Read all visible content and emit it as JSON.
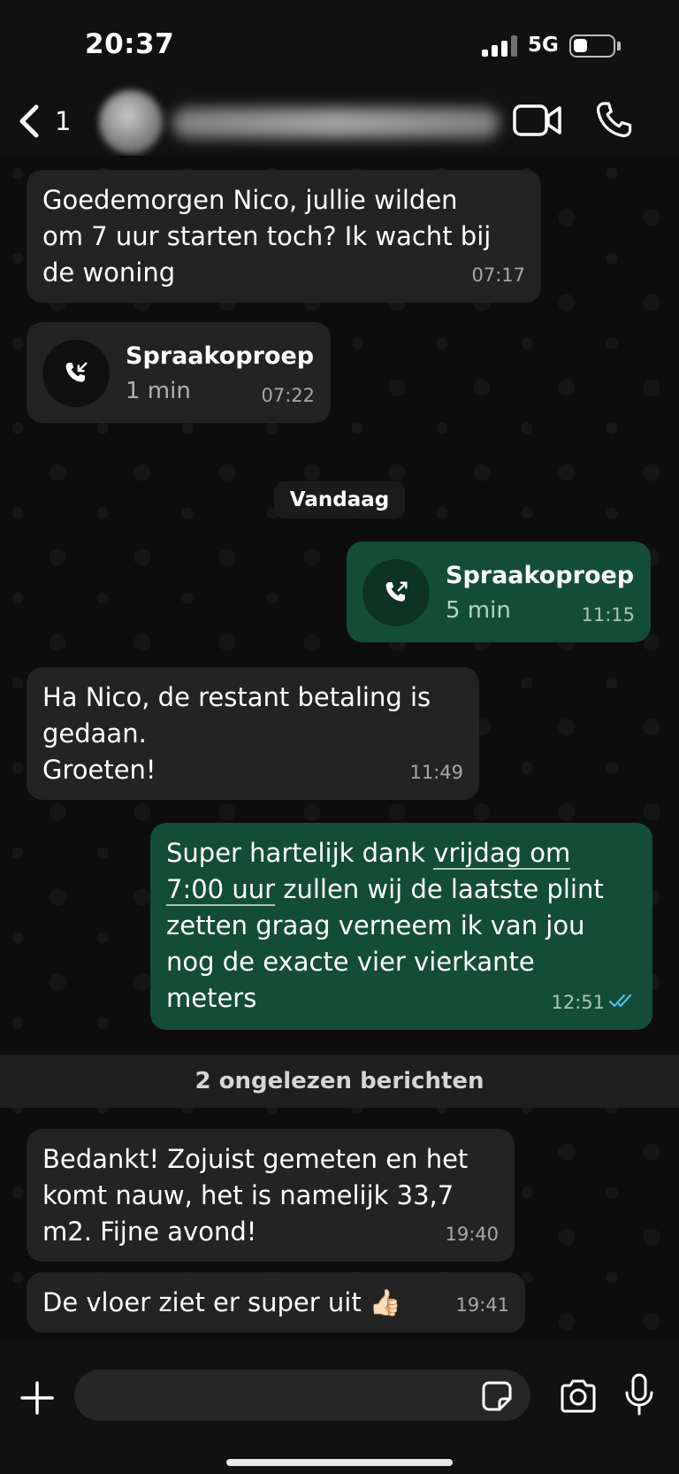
{
  "status_bar": {
    "time": "20:37",
    "network": "5G"
  },
  "header": {
    "back_count": "1",
    "icons": {
      "back": "chevron-left-icon",
      "video": "video-camera-icon",
      "call": "phone-icon"
    }
  },
  "messages": [
    {
      "direction": "incoming",
      "type": "text",
      "lines": [
        "Goedemorgen Nico, jullie wilden",
        "om 7 uur starten toch? Ik wacht bij",
        "de woning"
      ],
      "time": "07:17"
    },
    {
      "direction": "incoming",
      "type": "call",
      "title": "Spraakoproep",
      "duration": "1 min",
      "time": "07:22",
      "icon": "incoming-call-icon"
    },
    {
      "direction": "outgoing",
      "type": "call",
      "title": "Spraakoproep",
      "duration": "5 min",
      "time": "11:15",
      "icon": "outgoing-call-icon"
    },
    {
      "direction": "incoming",
      "type": "text",
      "lines": [
        "Ha Nico, de restant betaling is",
        "gedaan.",
        "Groeten!"
      ],
      "time": "11:49"
    },
    {
      "direction": "outgoing",
      "type": "text",
      "line1_pre": "Super hartelijk dank ",
      "line1_link": "vrijdag om",
      "line2_link": "7:00 uur",
      "line2_post": " zullen wij de laatste plint",
      "lines_rest": [
        "zetten graag verneem ik van jou",
        "nog de exacte vier vierkante",
        "meters"
      ],
      "time": "12:51",
      "read_status": "double-check-icon"
    },
    {
      "direction": "incoming",
      "type": "text",
      "lines": [
        "Bedankt! Zojuist gemeten en het",
        "komt nauw, het is namelijk 33,7",
        "m2. Fijne avond!"
      ],
      "time": "19:40"
    },
    {
      "direction": "incoming",
      "type": "text",
      "lines": [
        "De vloer ziet er super uit 👍🏻"
      ],
      "time": "19:41"
    }
  ],
  "date_separator": "Vandaag",
  "unread_banner": "2 ongelezen berichten",
  "input_bar": {
    "placeholder": "",
    "icons": {
      "add": "plus-icon",
      "sticker": "sticker-icon",
      "camera": "camera-icon",
      "mic": "microphone-icon"
    }
  },
  "colors": {
    "incoming_bubble": "#232323",
    "outgoing_bubble": "#144d37",
    "read_ticks": "#53bdeb",
    "background": "#0b0b0b"
  }
}
